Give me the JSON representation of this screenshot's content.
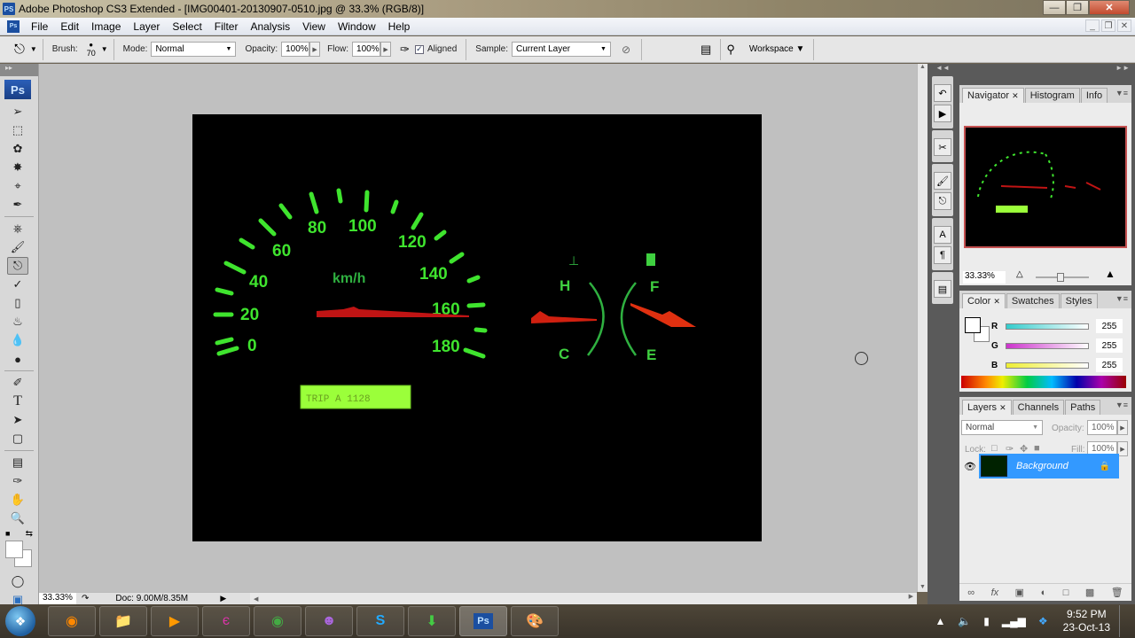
{
  "window": {
    "app_icon": "PS",
    "title": "Adobe Photoshop CS3 Extended - [IMG00401-20130907-0510.jpg @ 33.3% (RGB/8)]",
    "controls": [
      "minimize",
      "restore",
      "close"
    ]
  },
  "menubar": {
    "items": [
      "File",
      "Edit",
      "Image",
      "Layer",
      "Select",
      "Filter",
      "Analysis",
      "View",
      "Window",
      "Help"
    ]
  },
  "options": {
    "tool": "clone-stamp",
    "brush_label": "Brush:",
    "brush_size": "70",
    "mode_label": "Mode:",
    "mode_value": "Normal",
    "opacity_label": "Opacity:",
    "opacity_value": "100%",
    "flow_label": "Flow:",
    "flow_value": "100%",
    "aligned_label": "Aligned",
    "aligned_checked": true,
    "sample_label": "Sample:",
    "sample_value": "Current Layer",
    "workspace_label": "Workspace"
  },
  "toolbox": {
    "logo": "Ps",
    "tools": [
      "move",
      "marquee",
      "lasso",
      "magic-wand",
      "crop",
      "slice",
      "healing-brush",
      "brush",
      "clone-stamp",
      "history-brush",
      "eraser",
      "paint-bucket",
      "blur",
      "dodge",
      "pen",
      "type",
      "path-selection",
      "rectangle",
      "notes",
      "eyedropper",
      "hand",
      "zoom"
    ]
  },
  "canvas_image": {
    "speed_labels": [
      "0",
      "20",
      "40",
      "60",
      "80",
      "100",
      "120",
      "140",
      "160",
      "180"
    ],
    "unit": "km/h",
    "temp_labels": [
      "H",
      "C"
    ],
    "fuel_labels": [
      "F",
      "E"
    ],
    "odometer": "TRIP A 1128"
  },
  "status": {
    "zoom": "33.33%",
    "doc": "Doc: 9.00M/8.35M"
  },
  "navigator": {
    "tabs": [
      "Navigator",
      "Histogram",
      "Info"
    ],
    "zoom": "33.33%"
  },
  "color": {
    "tabs": [
      "Color",
      "Swatches",
      "Styles"
    ],
    "channels": [
      {
        "label": "R",
        "value": "255"
      },
      {
        "label": "G",
        "value": "255"
      },
      {
        "label": "B",
        "value": "255"
      }
    ]
  },
  "layers": {
    "tabs": [
      "Layers",
      "Channels",
      "Paths"
    ],
    "blend_mode": "Normal",
    "opacity_label": "Opacity:",
    "opacity_value": "100%",
    "lock_label": "Lock:",
    "fill_label": "Fill:",
    "fill_value": "100%",
    "items": [
      {
        "name": "Background",
        "visible": true,
        "locked": true,
        "selected": true
      }
    ]
  },
  "taskbar": {
    "apps": [
      "firefox",
      "explorer",
      "media-player",
      "app-e",
      "chrome",
      "yahoo-messenger",
      "skype",
      "internet-download-manager",
      "photoshop",
      "paint"
    ],
    "time": "9:52 PM",
    "date": "23-Oct-13"
  }
}
